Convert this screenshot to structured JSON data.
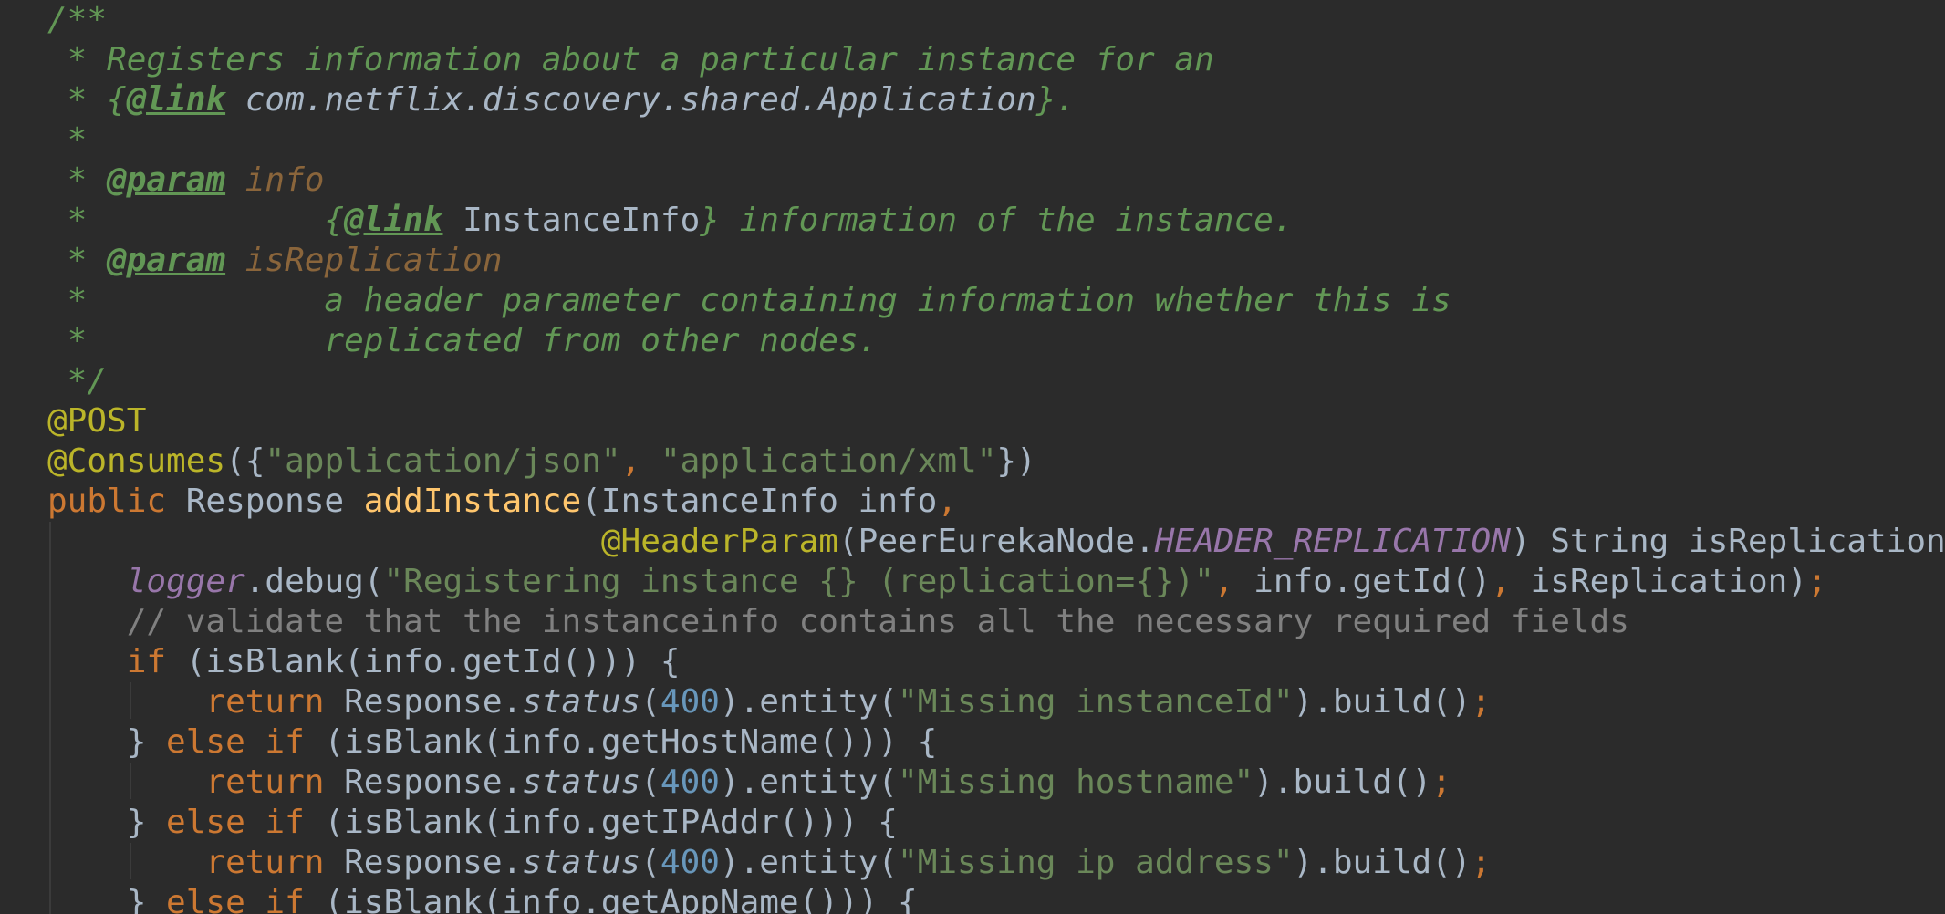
{
  "editor": {
    "lines": [
      [
        {
          "t": "/**",
          "c": "doc"
        }
      ],
      [
        {
          "t": " * Registers information about a particular instance for an",
          "c": "doc"
        }
      ],
      [
        {
          "t": " * {",
          "c": "doc"
        },
        {
          "t": "@link",
          "c": "doctag"
        },
        {
          "t": " com.netflix.discovery.shared.Application",
          "c": "docref"
        },
        {
          "t": "}.",
          "c": "doc"
        }
      ],
      [
        {
          "t": " *",
          "c": "doc"
        }
      ],
      [
        {
          "t": " * ",
          "c": "doc"
        },
        {
          "t": "@param",
          "c": "doctag"
        },
        {
          "t": " info",
          "c": "docpar"
        }
      ],
      [
        {
          "t": " *            {",
          "c": "doc"
        },
        {
          "t": "@link",
          "c": "doctag"
        },
        {
          "t": " InstanceInfo",
          "c": "docmono"
        },
        {
          "t": "} information of the instance.",
          "c": "doc"
        }
      ],
      [
        {
          "t": " * ",
          "c": "doc"
        },
        {
          "t": "@param",
          "c": "doctag"
        },
        {
          "t": " isReplication",
          "c": "docpar"
        }
      ],
      [
        {
          "t": " *            a header parameter containing information whether this is",
          "c": "doc"
        }
      ],
      [
        {
          "t": " *            replicated from other nodes.",
          "c": "doc"
        }
      ],
      [
        {
          "t": " */",
          "c": "doc"
        }
      ],
      [
        {
          "t": "@POST",
          "c": "ann"
        }
      ],
      [
        {
          "t": "@Consumes",
          "c": "ann"
        },
        {
          "t": "({",
          "c": "plain"
        },
        {
          "t": "\"application/json\"",
          "c": "str"
        },
        {
          "t": ", ",
          "c": "punc"
        },
        {
          "t": "\"application/xml\"",
          "c": "str"
        },
        {
          "t": "})",
          "c": "plain"
        }
      ],
      [
        {
          "t": "public ",
          "c": "kw"
        },
        {
          "t": "Response ",
          "c": "plain"
        },
        {
          "t": "addInstance",
          "c": "fn"
        },
        {
          "t": "(InstanceInfo info",
          "c": "plain"
        },
        {
          "t": ",",
          "c": "punc"
        }
      ],
      [
        {
          "t": "                            ",
          "c": "plain"
        },
        {
          "t": "@HeaderParam",
          "c": "ann"
        },
        {
          "t": "(PeerEurekaNode.",
          "c": "plain"
        },
        {
          "t": "HEADER_REPLICATION",
          "c": "const"
        },
        {
          "t": ") String isReplication) {",
          "c": "plain"
        }
      ],
      [
        {
          "t": "    ",
          "c": "plain"
        },
        {
          "t": "logger",
          "c": "field"
        },
        {
          "t": ".debug(",
          "c": "plain"
        },
        {
          "t": "\"Registering instance {} (replication={})\"",
          "c": "str"
        },
        {
          "t": ", ",
          "c": "punc"
        },
        {
          "t": "info.getId()",
          "c": "plain"
        },
        {
          "t": ", ",
          "c": "punc"
        },
        {
          "t": "isReplication)",
          "c": "plain"
        },
        {
          "t": ";",
          "c": "punc"
        }
      ],
      [
        {
          "t": "    // validate that the instanceinfo contains all the necessary required fields",
          "c": "cmt"
        }
      ],
      [
        {
          "t": "    ",
          "c": "plain"
        },
        {
          "t": "if ",
          "c": "kw"
        },
        {
          "t": "(isBlank(info.getId())) {",
          "c": "plain"
        }
      ],
      [
        {
          "t": "        ",
          "c": "plain"
        },
        {
          "t": "return ",
          "c": "kw"
        },
        {
          "t": "Response.",
          "c": "plain"
        },
        {
          "t": "status",
          "c": "static"
        },
        {
          "t": "(",
          "c": "plain"
        },
        {
          "t": "400",
          "c": "num"
        },
        {
          "t": ").entity(",
          "c": "plain"
        },
        {
          "t": "\"Missing instanceId\"",
          "c": "str"
        },
        {
          "t": ").build()",
          "c": "plain"
        },
        {
          "t": ";",
          "c": "punc"
        }
      ],
      [
        {
          "t": "    } ",
          "c": "plain"
        },
        {
          "t": "else if ",
          "c": "kw"
        },
        {
          "t": "(isBlank(info.getHostName())) {",
          "c": "plain"
        }
      ],
      [
        {
          "t": "        ",
          "c": "plain"
        },
        {
          "t": "return ",
          "c": "kw"
        },
        {
          "t": "Response.",
          "c": "plain"
        },
        {
          "t": "status",
          "c": "static"
        },
        {
          "t": "(",
          "c": "plain"
        },
        {
          "t": "400",
          "c": "num"
        },
        {
          "t": ").entity(",
          "c": "plain"
        },
        {
          "t": "\"Missing hostname\"",
          "c": "str"
        },
        {
          "t": ").build()",
          "c": "plain"
        },
        {
          "t": ";",
          "c": "punc"
        }
      ],
      [
        {
          "t": "    } ",
          "c": "plain"
        },
        {
          "t": "else if ",
          "c": "kw"
        },
        {
          "t": "(isBlank(info.getIPAddr())) {",
          "c": "plain"
        }
      ],
      [
        {
          "t": "        ",
          "c": "plain"
        },
        {
          "t": "return ",
          "c": "kw"
        },
        {
          "t": "Response.",
          "c": "plain"
        },
        {
          "t": "status",
          "c": "static"
        },
        {
          "t": "(",
          "c": "plain"
        },
        {
          "t": "400",
          "c": "num"
        },
        {
          "t": ").entity(",
          "c": "plain"
        },
        {
          "t": "\"Missing ip address\"",
          "c": "str"
        },
        {
          "t": ").build()",
          "c": "plain"
        },
        {
          "t": ";",
          "c": "punc"
        }
      ],
      [
        {
          "t": "    } ",
          "c": "plain"
        },
        {
          "t": "else if ",
          "c": "kw"
        },
        {
          "t": "(isBlank(info.getAppName())) {",
          "c": "plain"
        }
      ]
    ]
  },
  "colors": {
    "background": "#2b2b2b",
    "doc_comment": "#629755",
    "annotation": "#bbb529",
    "string": "#6a8759",
    "keyword": "#cc7832",
    "method": "#ffc66d",
    "number": "#6897bb",
    "constant": "#9876aa",
    "line_comment": "#808080",
    "default": "#a9b7c6"
  }
}
